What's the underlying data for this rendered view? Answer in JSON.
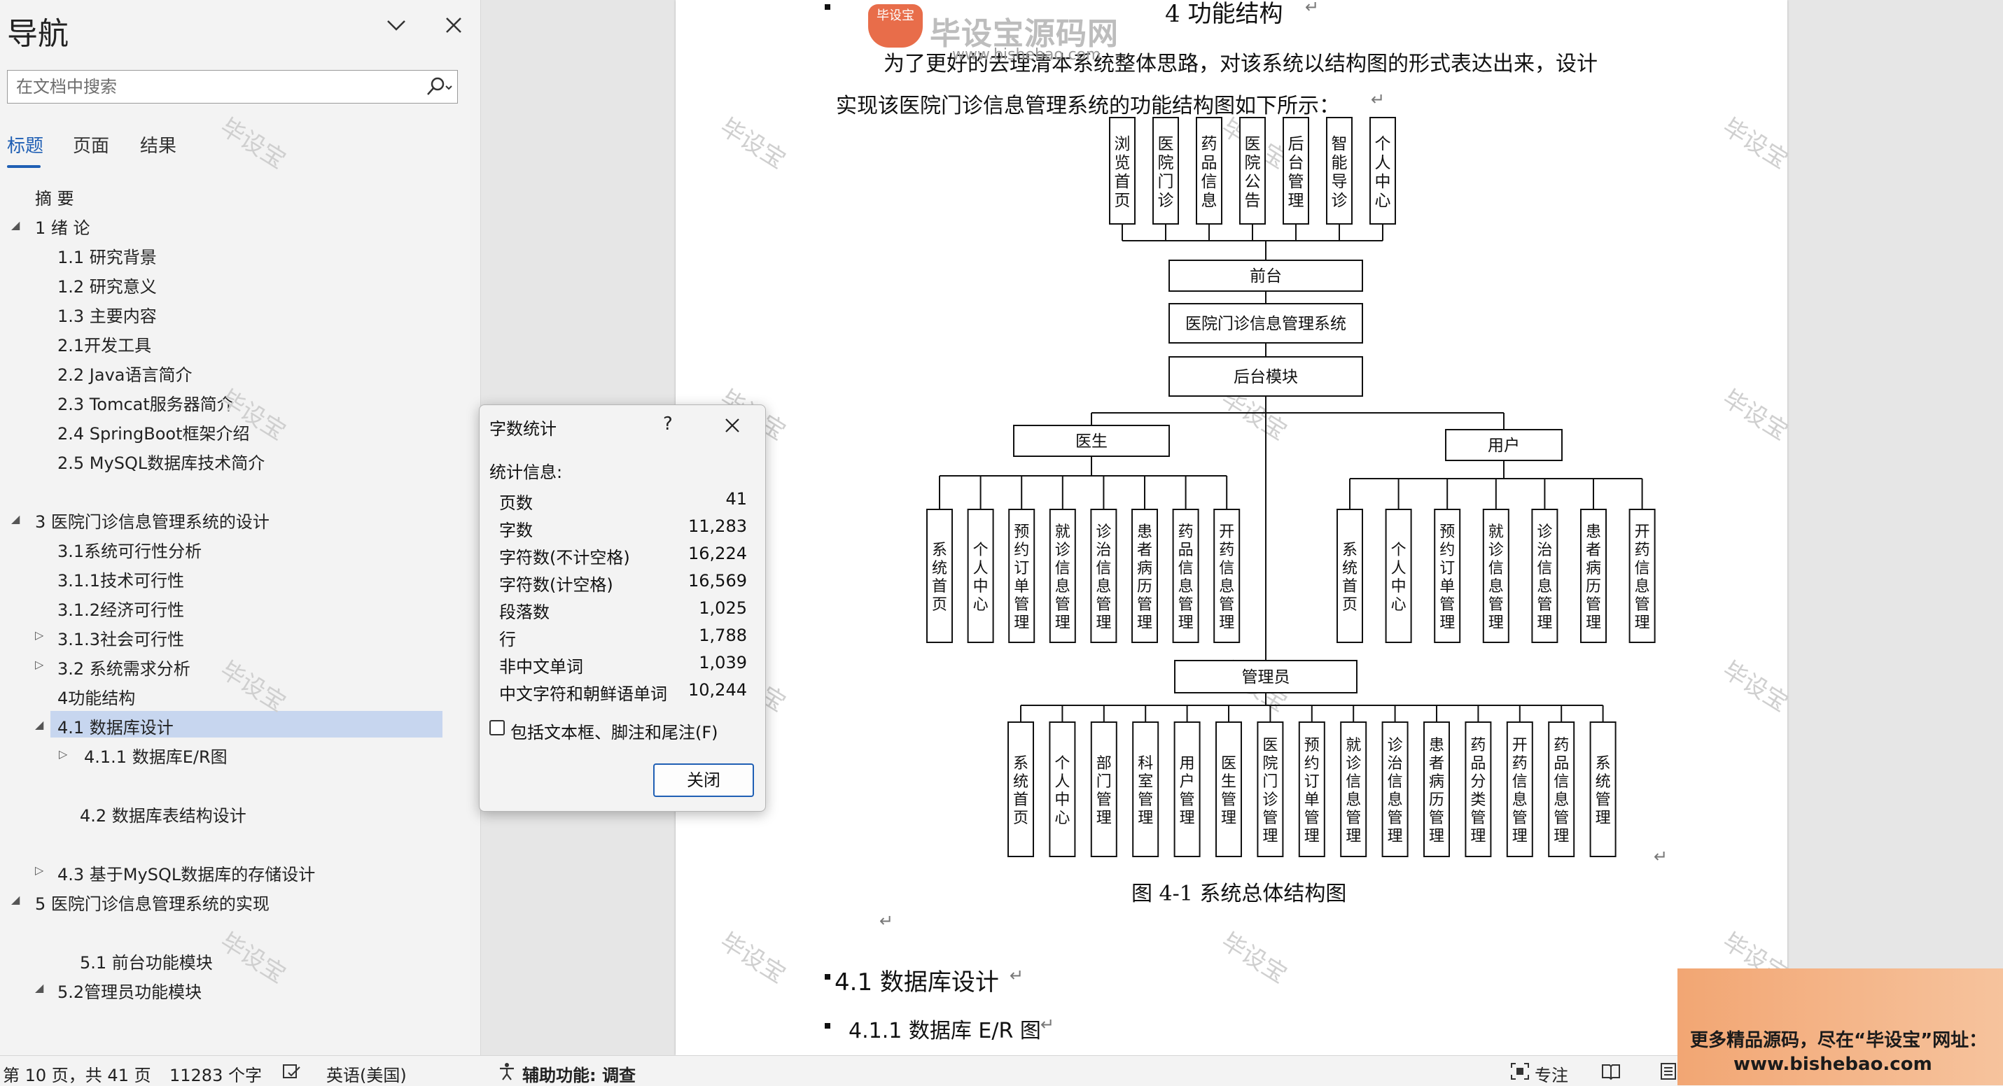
{
  "nav": {
    "title": "导航",
    "search_placeholder": "在文档中搜索",
    "tabs": [
      {
        "label": "标题",
        "active": true
      },
      {
        "label": "页面",
        "active": false
      },
      {
        "label": "结果",
        "active": false
      }
    ],
    "headings": [
      "摘 要",
      "1 绪 论",
      "1.1 研究背景",
      "1.2 研究意义",
      "1.3 主要内容",
      "2.1开发工具",
      "2.2 Java语言简介",
      "2.3 Tomcat服务器简介",
      "2.4 SpringBoot框架介绍",
      "2.5 MySQL数据库技术简介",
      "3 医院门诊信息管理系统的设计",
      "3.1系统可行性分析",
      "3.1.1技术可行性",
      "3.1.2经济可行性",
      "3.1.3社会可行性",
      "3.2 系统需求分析",
      "4功能结构",
      "4.1 数据库设计",
      "4.1.1 数据库E/R图",
      "4.2 数据库表结构设计",
      "4.3 基于MySQL数据库的存储设计",
      "5 医院门诊信息管理系统的实现",
      "5.1 前台功能模块",
      "5.2管理员功能模块"
    ]
  },
  "watermark": "毕设宝",
  "logo": {
    "badge": "毕设宝",
    "name": "毕设宝源码网",
    "url": "www.bishebao.com"
  },
  "document": {
    "heading4": "4 功能结构",
    "para_line1": "为了更好的去理清本系统整体思路，对该系统以结构图的形式表达出来，设计",
    "para_line2": "实现该医院门诊信息管理系统的功能结构图如下所示：",
    "figure_caption": "图 4-1  系统总体结构图",
    "heading41": "4.1  数据库设计",
    "heading411": "4.1.1  数据库 E/R 图",
    "diagram": {
      "front_items": [
        "浏览首页",
        "医院门诊",
        "药品信息",
        "医院公告",
        "后台管理",
        "智能导诊",
        "个人中心"
      ],
      "front": "前台",
      "system": "医院门诊信息管理系统",
      "backend": "后台模块",
      "doctor": "医生",
      "user": "用户",
      "admin": "管理员",
      "doctor_items": [
        "系统首页",
        "个人中心",
        "预约订单管理",
        "就诊信息管理",
        "诊治信息管理",
        "患者病历管理",
        "药品信息管理",
        "开药信息管理"
      ],
      "user_items": [
        "系统首页",
        "个人中心",
        "预约订单管理",
        "就诊信息管理",
        "诊治信息管理",
        "患者病历管理",
        "开药信息管理"
      ],
      "admin_items": [
        "系统首页",
        "个人中心",
        "部门管理",
        "科室管理",
        "用户管理",
        "医生管理",
        "医院门诊管理",
        "预约订单管理",
        "就诊信息管理",
        "诊治信息管理",
        "患者病历管理",
        "药品分类管理",
        "开药信息管理",
        "药品信息管理",
        "系统管理"
      ]
    }
  },
  "dialog": {
    "title": "字数统计",
    "help": "?",
    "section": "统计信息:",
    "stats": [
      {
        "label": "页数",
        "value": "41"
      },
      {
        "label": "字数",
        "value": "11,283"
      },
      {
        "label": "字符数(不计空格)",
        "value": "16,224"
      },
      {
        "label": "字符数(计空格)",
        "value": "16,569"
      },
      {
        "label": "段落数",
        "value": "1,025"
      },
      {
        "label": "行",
        "value": "1,788"
      },
      {
        "label": "非中文单词",
        "value": "1,039"
      },
      {
        "label": "中文字符和朝鲜语单词",
        "value": "10,244"
      }
    ],
    "checkbox_label": "包括文本框、脚注和尾注(F)",
    "close_label": "关闭"
  },
  "status": {
    "page": "第 10 页，共 41 页",
    "words": "11283 个字",
    "language": "英语(美国)",
    "accessibility": "辅助功能: 调查",
    "focus": "专注"
  },
  "ad": {
    "line1": "更多精品源码，尽在“毕设宝”网址：",
    "line2": "www.bishebao.com"
  }
}
